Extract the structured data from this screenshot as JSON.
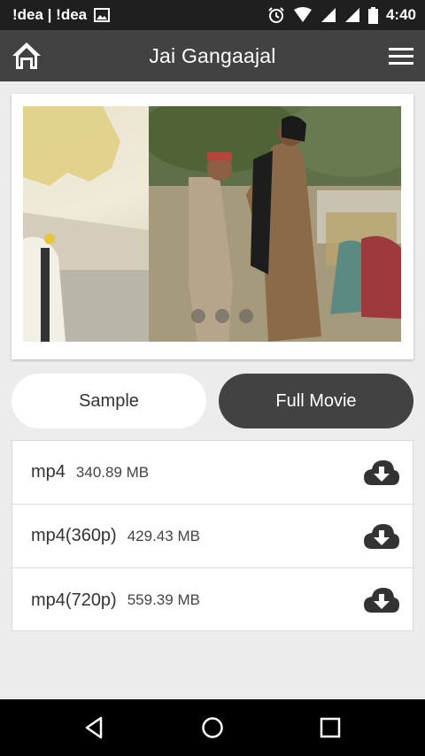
{
  "status_bar": {
    "carrier": "!dea | !dea",
    "time": "4:40",
    "icons": [
      "image-icon",
      "alarm-icon",
      "wifi-icon",
      "signal-icon",
      "signal-icon",
      "battery-icon"
    ]
  },
  "header": {
    "title": "Jai Gangaajal",
    "home_icon": "home-icon",
    "menu_icon": "menu-icon"
  },
  "carousel": {
    "page_count": 3,
    "current_page": 1
  },
  "toggle": {
    "sample_label": "Sample",
    "full_movie_label": "Full Movie",
    "selected": "Full Movie"
  },
  "files": [
    {
      "format": "mp4",
      "size": "340.89 MB",
      "icon": "cloud-download-icon"
    },
    {
      "format": "mp4(360p)",
      "size": "429.43 MB",
      "icon": "cloud-download-icon"
    },
    {
      "format": "mp4(720p)",
      "size": "559.39 MB",
      "icon": "cloud-download-icon"
    }
  ],
  "nav_bar": {
    "icons": [
      "back-icon",
      "home-circle-icon",
      "recents-icon"
    ]
  },
  "colors": {
    "header_bg": "#424242",
    "status_bar_bg": "#1f1f1f",
    "page_bg": "#ececec",
    "selected_toggle_bg": "#424242",
    "unselected_toggle_bg": "#ffffff"
  }
}
